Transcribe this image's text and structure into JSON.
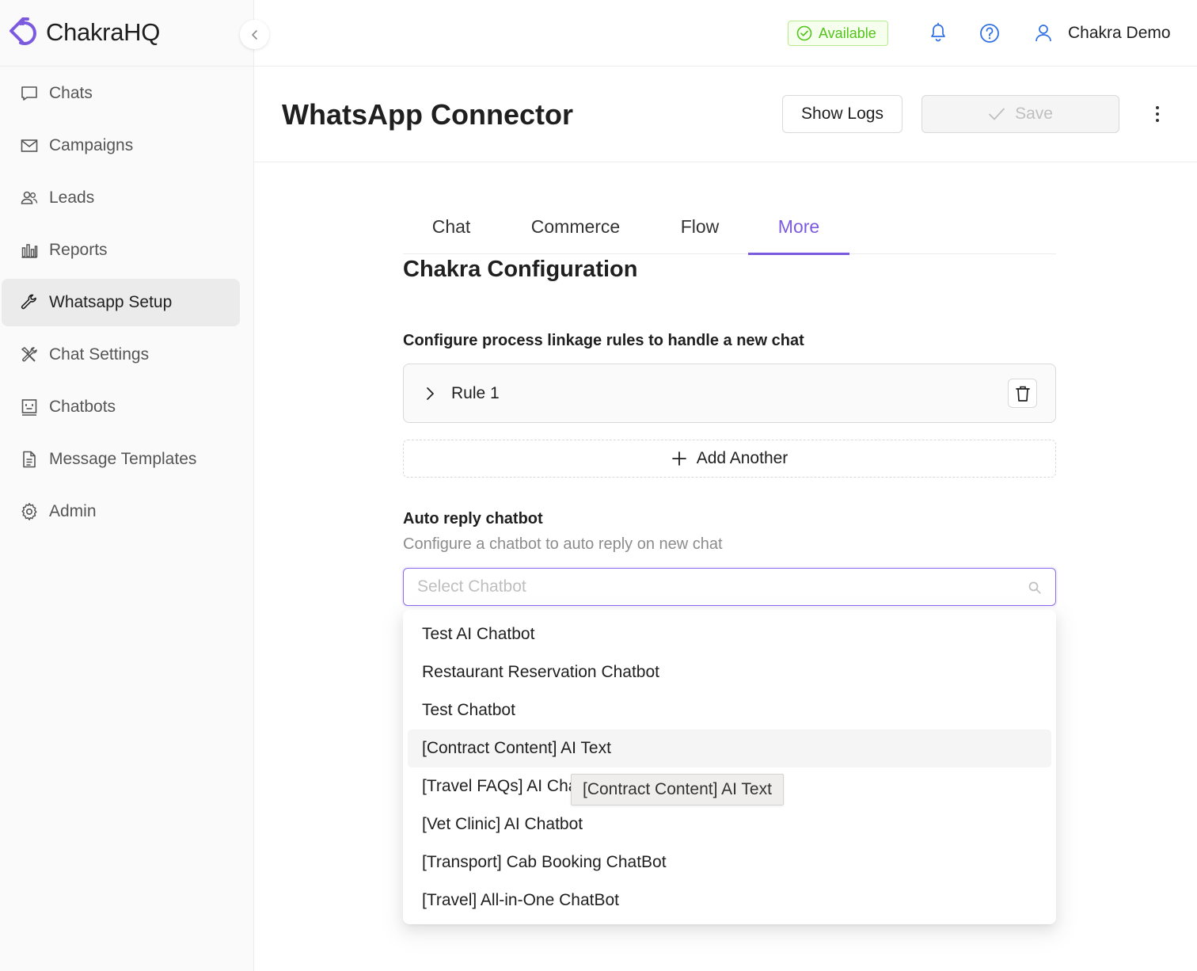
{
  "app": {
    "logo_text": "ChakraHQ",
    "accent_color": "#7c5ae0"
  },
  "sidebar": {
    "items": [
      {
        "label": "Chats",
        "icon": "chat-icon"
      },
      {
        "label": "Campaigns",
        "icon": "mail-icon"
      },
      {
        "label": "Leads",
        "icon": "users-icon"
      },
      {
        "label": "Reports",
        "icon": "bar-chart-icon"
      },
      {
        "label": "Whatsapp Setup",
        "icon": "wrench-icon",
        "active": true
      },
      {
        "label": "Chat Settings",
        "icon": "tools-icon"
      },
      {
        "label": "Chatbots",
        "icon": "robot-icon"
      },
      {
        "label": "Message Templates",
        "icon": "document-icon"
      },
      {
        "label": "Admin",
        "icon": "gear-icon"
      }
    ]
  },
  "topbar": {
    "status": "Available",
    "status_color": "#52c41a",
    "user_name": "Chakra Demo"
  },
  "header": {
    "title": "WhatsApp Connector",
    "show_logs_label": "Show Logs",
    "save_label": "Save"
  },
  "tabs": [
    {
      "label": "Chat"
    },
    {
      "label": "Commerce"
    },
    {
      "label": "Flow"
    },
    {
      "label": "More",
      "active": true
    }
  ],
  "config": {
    "section_title": "Chakra Configuration",
    "rules_label": "Configure process linkage rules to handle a new chat",
    "rules": [
      {
        "name": "Rule 1"
      }
    ],
    "add_another_label": "Add Another",
    "auto_reply_label": "Auto reply chatbot",
    "auto_reply_desc": "Configure a chatbot to auto reply on new chat",
    "select_placeholder": "Select Chatbot",
    "select_value": ""
  },
  "dropdown": {
    "options": [
      "Test AI Chatbot",
      "Restaurant Reservation Chatbot",
      "Test Chatbot",
      "[Contract Content] AI Text",
      "[Travel FAQs] AI Chatbot",
      "[Vet Clinic] AI Chatbot",
      "[Transport] Cab Booking ChatBot",
      "[Travel] All-in-One ChatBot"
    ],
    "hovered_index": 3,
    "tooltip": "[Contract Content] AI Text"
  }
}
